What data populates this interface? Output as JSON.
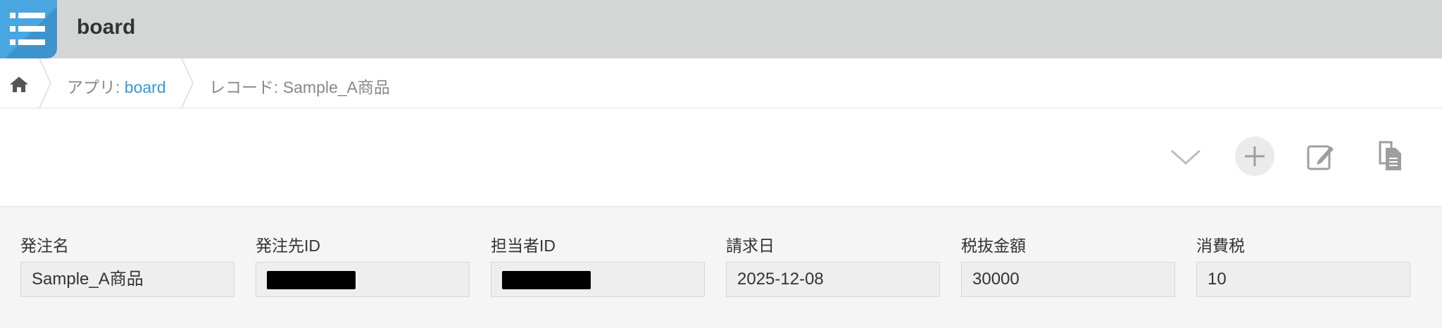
{
  "header": {
    "title": "board"
  },
  "breadcrumb": {
    "app_prefix": "アプリ: ",
    "app_link": "board",
    "record": "レコード: Sample_A商品"
  },
  "toolbar": {
    "icons": [
      "chevron-down-icon",
      "plus-icon",
      "edit-icon",
      "copy-icon"
    ]
  },
  "fields": [
    {
      "label": "発注名",
      "value": "Sample_A商品"
    },
    {
      "label": "発注先ID",
      "value": "",
      "redacted": true
    },
    {
      "label": "担当者ID",
      "value": "",
      "redacted": true
    },
    {
      "label": "請求日",
      "value": "2025-12-08"
    },
    {
      "label": "税抜金額",
      "value": "30000"
    },
    {
      "label": "消費税",
      "value": "10"
    }
  ],
  "colors": {
    "accent": "#3498db",
    "app_icon": "#4aa6e0",
    "header_bg": "#d4d6d6"
  }
}
